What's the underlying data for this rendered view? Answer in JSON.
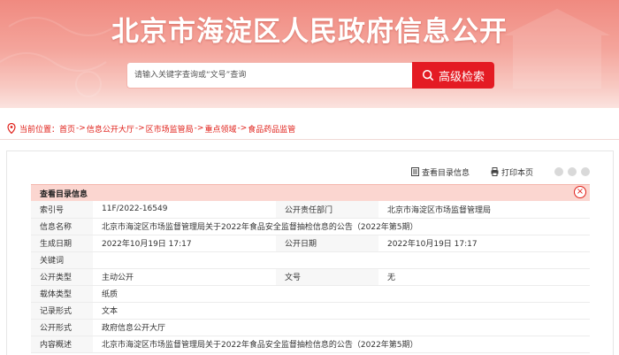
{
  "header": {
    "title": "北京市海淀区人民政府信息公开"
  },
  "search": {
    "placeholder": "请输入关键字查询或“文号”查询",
    "button_label": "高级检索"
  },
  "breadcrumb": {
    "prefix": "当前位置：",
    "items": [
      "首页",
      "信息公开大厅",
      "区市场监管局",
      "重点领域",
      "食品药品监管"
    ],
    "separator": "->"
  },
  "toolbar": {
    "view_catalog": "查看目录信息",
    "print": "打印本页"
  },
  "info": {
    "header": "查看目录信息",
    "rows": {
      "index_no": {
        "label": "索引号",
        "value": "11F/2022-16549"
      },
      "dept": {
        "label": "公开责任部门",
        "value": "北京市海淀区市场监督管理局"
      },
      "name": {
        "label": "信息名称",
        "value": "北京市海淀区市场监督管理局关于2022年食品安全监督抽检信息的公告（2022年第5期）"
      },
      "created": {
        "label": "生成日期",
        "value": "2022年10月19日 17:17"
      },
      "published": {
        "label": "公开日期",
        "value": "2022年10月19日 17:17"
      },
      "keywords": {
        "label": "关键词",
        "value": ""
      },
      "disclosure_type": {
        "label": "公开类型",
        "value": "主动公开"
      },
      "doc_no": {
        "label": "文号",
        "value": "无"
      },
      "carrier": {
        "label": "载体类型",
        "value": "纸质"
      },
      "record_form": {
        "label": "记录形式",
        "value": "文本"
      },
      "disclosure_form": {
        "label": "公开形式",
        "value": "政府信息公开大厅"
      },
      "summary": {
        "label": "内容概述",
        "value": "北京市海淀区市场监督管理局关于2022年食品安全监督抽检信息的公告（2022年第5期）"
      }
    }
  },
  "colors": {
    "accent": "#e41b23",
    "banner": "#f4a49b",
    "header_row": "#fbd6d0"
  },
  "icons": [
    "search-icon",
    "location-pin-icon",
    "catalog-icon",
    "print-icon",
    "share-icon",
    "close-icon"
  ]
}
